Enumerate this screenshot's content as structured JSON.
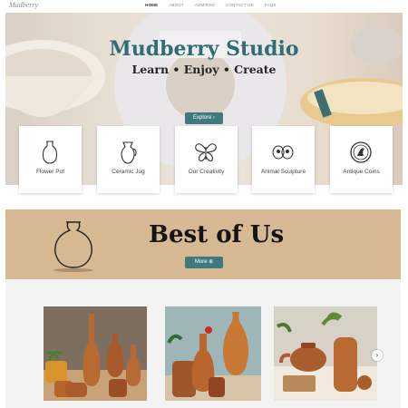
{
  "header": {
    "logo_text": "Mudberry",
    "nav": [
      "HOME",
      "ABOUT",
      "ADMIRED",
      "CONTACT US",
      "FAQS"
    ]
  },
  "hero": {
    "title": "Mudberry Studio",
    "subtitle": "Learn • Enjoy • Create",
    "button_label": "Explore ›"
  },
  "categories": [
    {
      "label": "Flower Pot",
      "icon": "flower-pot-icon"
    },
    {
      "label": "Ceramic Jug",
      "icon": "ceramic-jug-icon"
    },
    {
      "label": "Our Creativity",
      "icon": "butterfly-icon"
    },
    {
      "label": "Animal Sculpture",
      "icon": "animal-sculpture-icon"
    },
    {
      "label": "Antique Coins",
      "icon": "coin-icon"
    }
  ],
  "best": {
    "title": "Best of Us",
    "button_label": "More ⊕"
  },
  "gallery": {
    "next_label": "›"
  },
  "colors": {
    "teal": "#2f6f73",
    "button": "#3f7a7e",
    "band": "#d6b892",
    "terracotta": "#b5652c"
  }
}
